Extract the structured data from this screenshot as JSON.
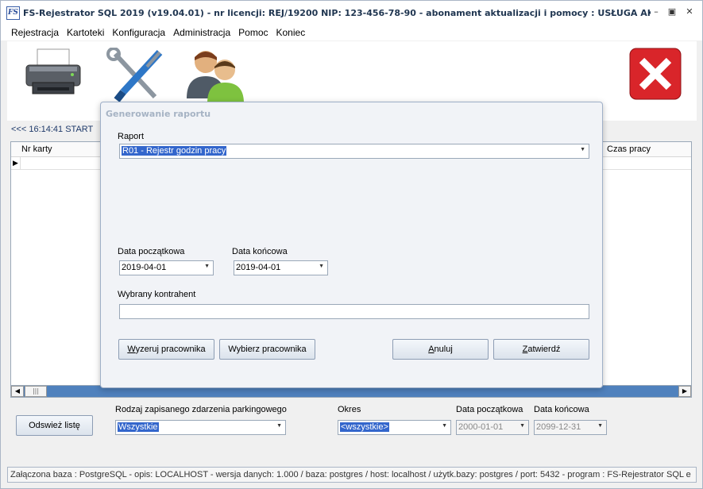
{
  "window": {
    "title": "FS-Rejestrator SQL 2019 (v19.04.01)    -    nr licencji: REJ/19200    NIP: 123-456-78-90    -    abonament aktualizacji i pomocy : USŁUGA AK...",
    "app_icon_text": "FS",
    "minimize_glyph": "–",
    "maximize_glyph": "▣",
    "close_glyph": "✕"
  },
  "menu": [
    "Rejestracja",
    "Kartoteki",
    "Konfiguracja",
    "Administracja",
    "Pomoc",
    "Koniec"
  ],
  "toolbar": {
    "icons": [
      "printer-icon",
      "tools-icon",
      "users-icon",
      "exit-icon"
    ]
  },
  "status_line": "<<<  16:14:41  START",
  "grid": {
    "columns": [
      "Nr karty",
      "Czas pracy"
    ],
    "row_indicator": "▶"
  },
  "scrollbar": {
    "left": "◀",
    "right": "▶",
    "thumb": "|||"
  },
  "dialog": {
    "title": "Generowanie raportu",
    "raport_label": "Raport",
    "raport_value": "R01 - Rejestr godzin pracy",
    "start_date_label": "Data początkowa",
    "start_date_value": "2019-04-01",
    "end_date_label": "Data końcowa",
    "end_date_value": "2019-04-01",
    "contractor_label": "Wybrany kontrahent",
    "contractor_value": "",
    "clear_employee_button": "Wyzeruj pracownika",
    "choose_employee_button": "Wybierz pracownika",
    "cancel_button": "Anuluj",
    "confirm_button": "Zatwierdź"
  },
  "bottom": {
    "refresh_button": "Odswież listę",
    "event_type_label": "Rodzaj zapisanego zdarzenia parkingowego",
    "event_type_value": "Wszystkie",
    "period_label": "Okres",
    "period_value": "<wszystkie>",
    "start_date_label": "Data początkowa",
    "start_date_value": "2000-01-01",
    "end_date_label": "Data końcowa",
    "end_date_value": "2099-12-31"
  },
  "footer": "Załączona baza : PostgreSQL - opis: LOCALHOST - wersja danych: 1.000  / baza: postgres / host: localhost / użytk.bazy: postgres /  port: 5432  - program :  FS-Rejestrator SQL e",
  "colors": {
    "accent": "#4f81bd",
    "selection": "#3366cc",
    "exit_red": "#d9252a"
  }
}
